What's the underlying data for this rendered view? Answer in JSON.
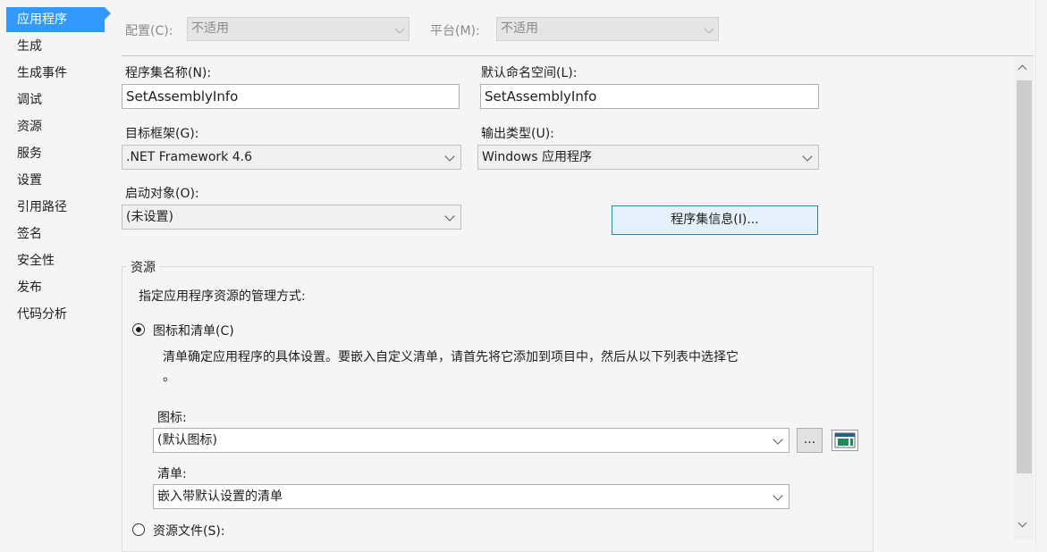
{
  "sidebar": {
    "items": [
      {
        "label": "应用程序"
      },
      {
        "label": "生成"
      },
      {
        "label": "生成事件"
      },
      {
        "label": "调试"
      },
      {
        "label": "资源"
      },
      {
        "label": "服务"
      },
      {
        "label": "设置"
      },
      {
        "label": "引用路径"
      },
      {
        "label": "签名"
      },
      {
        "label": "安全性"
      },
      {
        "label": "发布"
      },
      {
        "label": "代码分析"
      }
    ],
    "active_index": 0
  },
  "config_bar": {
    "configuration_label": "配置(C):",
    "configuration_value": "不适用",
    "platform_label": "平台(M):",
    "platform_value": "不适用"
  },
  "form": {
    "assembly_name_label": "程序集名称(N):",
    "assembly_name_value": "SetAssemblyInfo",
    "default_namespace_label": "默认命名空间(L):",
    "default_namespace_value": "SetAssemblyInfo",
    "target_framework_label": "目标框架(G):",
    "target_framework_value": ".NET Framework 4.6",
    "output_type_label": "输出类型(U):",
    "output_type_value": "Windows 应用程序",
    "startup_object_label": "启动对象(O):",
    "startup_object_value": "(未设置)",
    "assembly_info_button": "程序集信息(I)..."
  },
  "resources": {
    "group_title": "资源",
    "description": "指定应用程序资源的管理方式:",
    "icon_manifest_radio": "图标和清单(C)",
    "icon_manifest_selected": true,
    "manifest_hint_line1": "清单确定应用程序的具体设置。要嵌入自定义清单，请首先将它添加到项目中，然后从以下列表中选择它",
    "manifest_hint_line2": "。",
    "icon_label": "图标:",
    "icon_value": "(默认图标)",
    "browse_button": "...",
    "manifest_label": "清单:",
    "manifest_value": "嵌入带默认设置的清单",
    "resource_file_radio": "资源文件(S):",
    "resource_file_selected": false
  },
  "colors": {
    "accent": "#3399ff",
    "button_border": "#3c7fb1",
    "background": "#f5f5f5"
  }
}
